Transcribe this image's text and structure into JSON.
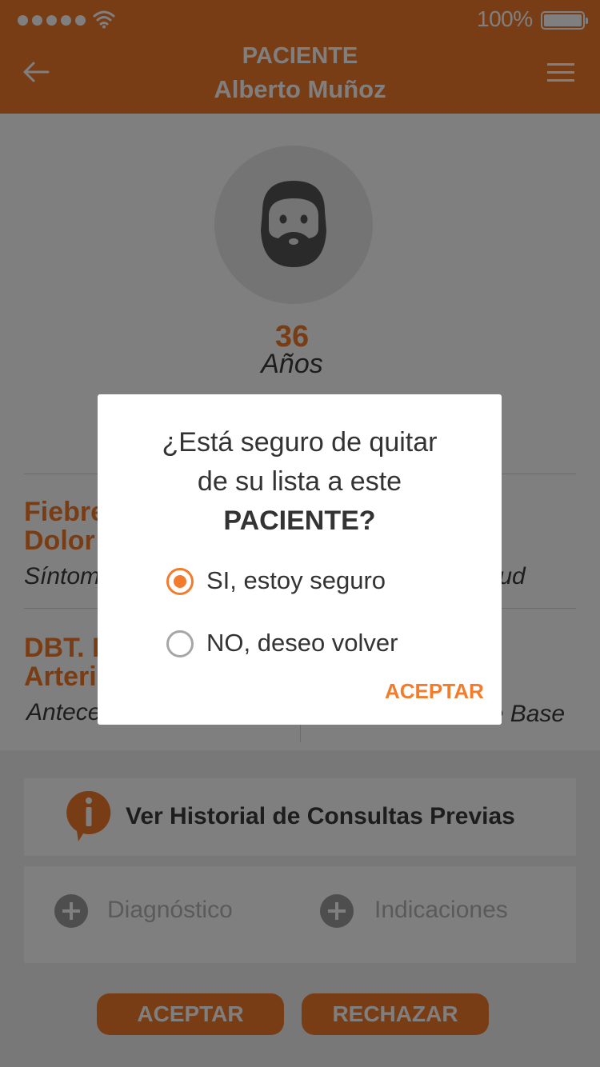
{
  "status_bar": {
    "signal_dots": 5,
    "battery_percent": "100%"
  },
  "header": {
    "title": "PACIENTE",
    "patient_name": "Alberto Muñoz"
  },
  "patient": {
    "age": "36",
    "age_unit": "Años"
  },
  "info_rows": [
    {
      "title_lines": [
        "Fiebre",
        "Dolor"
      ],
      "subtitle": "Síntomas",
      "right_subtitle": "alud"
    },
    {
      "title_lines": [
        "DBT. H",
        "Arteri"
      ],
      "subtitle": "Antece",
      "right_subtitle": "de Base"
    }
  ],
  "history_button": {
    "label": "Ver Historial de Consultas Previas"
  },
  "actions": {
    "diagnosis": "Diagnóstico",
    "indications": "Indicaciones"
  },
  "buttons": {
    "accept": "ACEPTAR",
    "reject": "RECHAZAR"
  },
  "dialog": {
    "title_line1": "¿Está seguro de quitar",
    "title_line2": "de su lista a este",
    "title_line3": "PACIENTE?",
    "options": [
      {
        "label": "SI, estoy seguro",
        "selected": true
      },
      {
        "label": "NO, deseo volver",
        "selected": false
      }
    ],
    "confirm": "ACEPTAR"
  },
  "colors": {
    "accent": "#f37b2b",
    "text": "#333333",
    "overlay": "rgba(0,0,0,0.5)"
  }
}
